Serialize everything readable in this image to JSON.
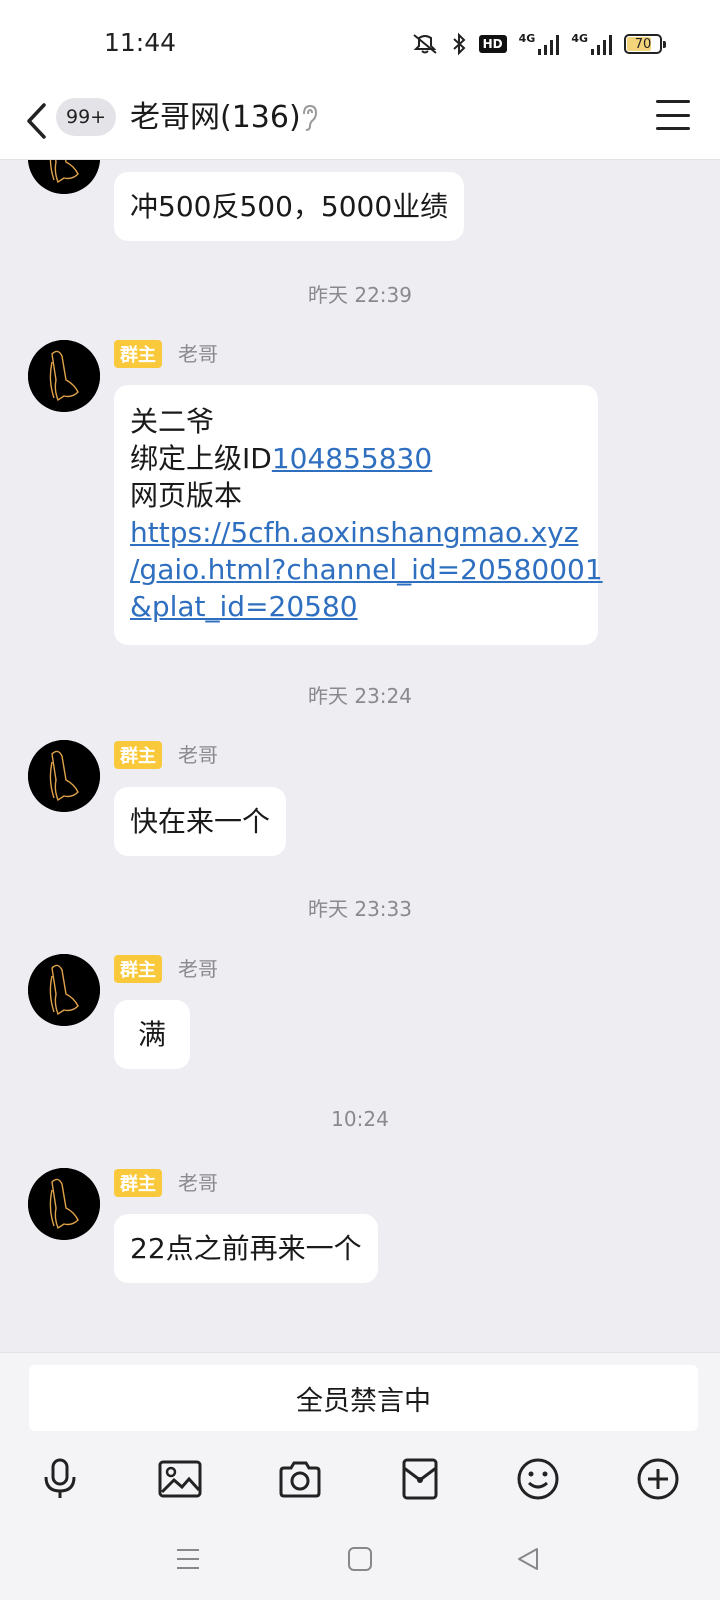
{
  "status_bar": {
    "time": "11:44",
    "network_1": "4G",
    "network_2": "4G",
    "hd_label": "HD",
    "battery_level": "70"
  },
  "nav": {
    "unread_badge": "99+",
    "title": "老哥网(136)"
  },
  "messages": [
    {
      "text": "冲500反500，5000业绩"
    },
    {
      "timestamp": "昨天 22:39",
      "role": "群主",
      "sender": "老哥",
      "lines": [
        {
          "text": "关二爷"
        },
        {
          "text": "绑定上级ID",
          "link": "104855830"
        },
        {
          "text": "网页版本"
        }
      ],
      "url_lines": [
        "https://5cfh.aoxinshangmao.xyz",
        "/gaio.html?channel_id=20580001",
        "&plat_id=20580"
      ]
    },
    {
      "timestamp": "昨天 23:24",
      "role": "群主",
      "sender": "老哥",
      "text": "快在来一个"
    },
    {
      "timestamp": "昨天 23:33",
      "role": "群主",
      "sender": "老哥",
      "text": "满"
    },
    {
      "timestamp": "10:24",
      "role": "群主",
      "sender": "老哥",
      "text": "22点之前再来一个"
    }
  ],
  "input_area": {
    "muted_notice": "全员禁言中",
    "tools": [
      "microphone-icon",
      "image-icon",
      "camera-icon",
      "red-packet-icon",
      "emoji-icon",
      "plus-icon"
    ]
  },
  "colors": {
    "accent_link": "#2F6FBF",
    "role_tag": "#F9C93B",
    "chat_background": "#EDEDF2"
  }
}
